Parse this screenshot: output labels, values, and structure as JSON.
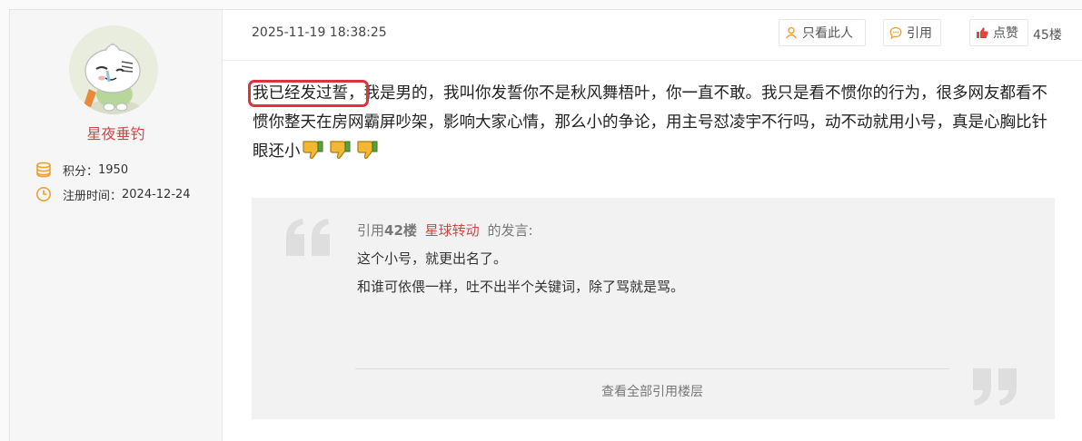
{
  "user": {
    "name": "星夜垂钓",
    "points_label": "积分：",
    "points_value": "1950",
    "register_label": "注册时间：",
    "register_date": "2024-12-24"
  },
  "post": {
    "timestamp": "2025-11-19 18:38:25",
    "floor": "45楼",
    "actions": {
      "only_this_user": "只看此人",
      "quote": "引用",
      "like": "点赞"
    },
    "content": {
      "highlighted": "我已经发过誓，",
      "body": "我是男的，我叫你发誓你不是秋风舞梧叶，你一直不敢。我只是看不惯你的行为，很多网友都看不惯你整天在房网霸屏吵架，影响大家心情，那么小的争论，用主号怼凌宇不行吗，动不动就用小号，真是心胸比针眼还小"
    },
    "quote": {
      "prefix": "引用",
      "floor": "42楼",
      "author": "星球转动",
      "suffix": "的发言:",
      "lines": [
        "这个小号，就更出名了。",
        "和谁可依偎一样，吐不出半个关键词，除了骂就是骂。"
      ],
      "view_all": "查看全部引用楼层"
    }
  },
  "colors": {
    "accent_red": "#c7494a",
    "highlight_box": "#e0323a",
    "icon_orange": "#f0a030"
  },
  "icons": [
    "avatar-image",
    "coins-icon",
    "clock-icon",
    "person-icon",
    "chat-bubble-icon",
    "thumbs-up-icon",
    "thumbs-down-emoji",
    "open-quote-icon",
    "close-quote-icon"
  ]
}
